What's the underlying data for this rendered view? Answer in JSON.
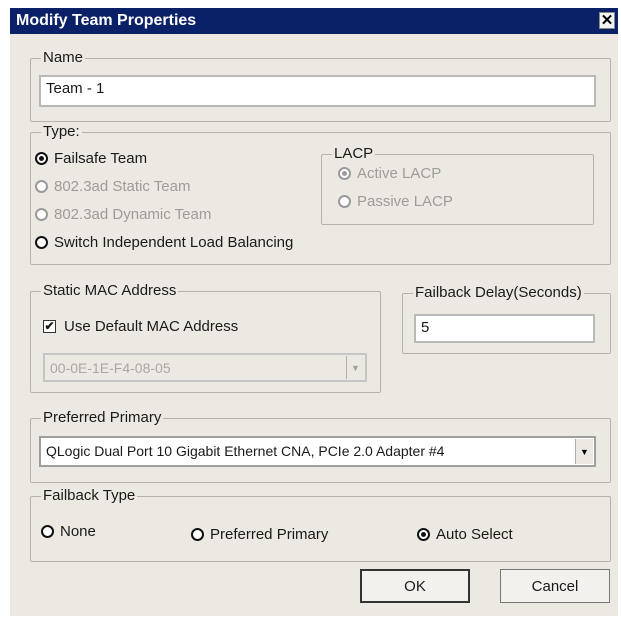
{
  "window": {
    "title": "Modify Team Properties",
    "close_glyph": "✕"
  },
  "name_group": {
    "legend": "Name",
    "value": "Team - 1"
  },
  "type_group": {
    "legend": "Type:",
    "options": [
      {
        "label": "Failsafe Team",
        "checked": true,
        "enabled": true
      },
      {
        "label": "802.3ad Static Team",
        "checked": false,
        "enabled": false
      },
      {
        "label": "802.3ad Dynamic Team",
        "checked": false,
        "enabled": false
      },
      {
        "label": "Switch Independent Load Balancing",
        "checked": false,
        "enabled": true
      }
    ],
    "lacp": {
      "legend": "LACP",
      "options": [
        {
          "label": "Active LACP",
          "checked": true,
          "enabled": false
        },
        {
          "label": "Passive LACP",
          "checked": false,
          "enabled": false
        }
      ]
    }
  },
  "static_mac": {
    "legend": "Static MAC Address",
    "use_default_label": "Use Default MAC Address",
    "use_default_checked": true,
    "mac_value": "00-0E-1E-F4-08-05"
  },
  "failback_delay": {
    "legend": "Failback Delay(Seconds)",
    "value": "5"
  },
  "preferred_primary": {
    "legend": "Preferred Primary",
    "value": "QLogic Dual Port 10 Gigabit Ethernet CNA, PCIe 2.0 Adapter #4"
  },
  "failback_type": {
    "legend": "Failback Type",
    "options": [
      {
        "label": "None",
        "checked": false
      },
      {
        "label": "Preferred Primary",
        "checked": false
      },
      {
        "label": "Auto Select",
        "checked": true
      }
    ]
  },
  "buttons": {
    "ok": "OK",
    "cancel": "Cancel"
  },
  "icons": {
    "dropdown_arrow": "▼",
    "check_mark": "✔"
  }
}
